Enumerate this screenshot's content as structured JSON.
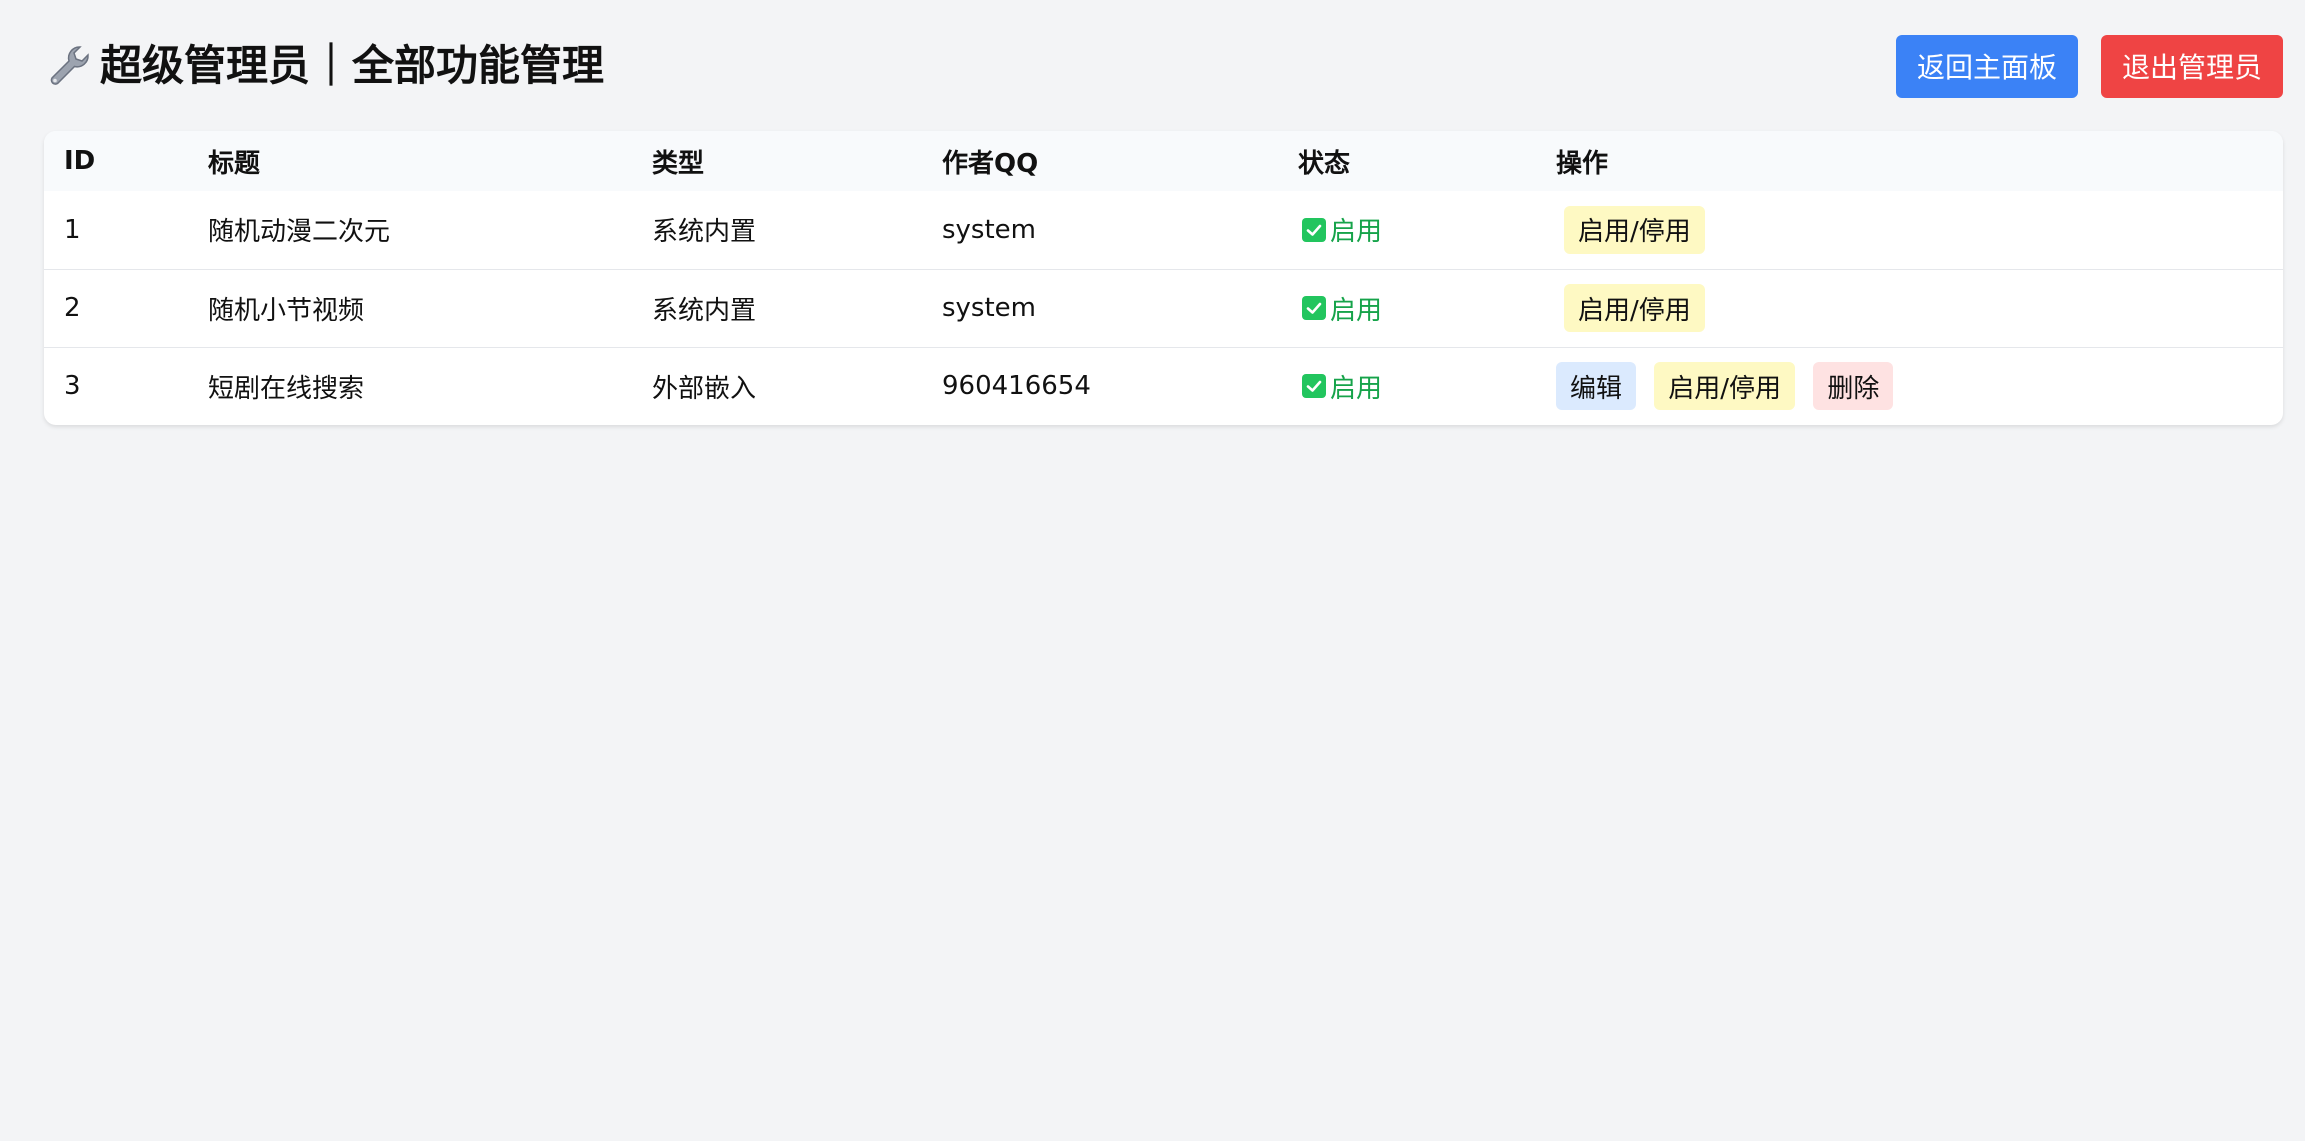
{
  "header": {
    "title": "超级管理员｜全部功能管理",
    "back_label": "返回主面板",
    "logout_label": "退出管理员"
  },
  "colors": {
    "blue": "#3b82f6",
    "red": "#ef4444",
    "status_green": "#16a34a"
  },
  "table": {
    "columns": [
      "ID",
      "标题",
      "类型",
      "作者QQ",
      "状态",
      "操作"
    ],
    "rows": [
      {
        "id": "1",
        "title": "随机动漫二次元",
        "type": "系统内置",
        "qq": "system",
        "status": "启用",
        "toggle": "启用/停用"
      },
      {
        "id": "2",
        "title": "随机小节视频",
        "type": "系统内置",
        "qq": "system",
        "status": "启用",
        "toggle": "启用/停用"
      },
      {
        "id": "3",
        "title": "短剧在线搜索",
        "type": "外部嵌入",
        "qq": "960416654",
        "status": "启用",
        "edit": "编辑",
        "toggle": "启用/停用",
        "delete": "删除"
      }
    ]
  }
}
